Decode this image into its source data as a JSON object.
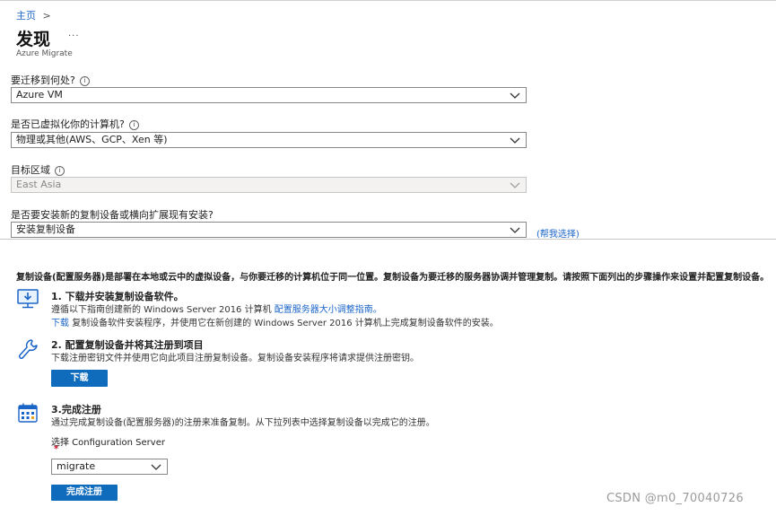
{
  "breadcrumb": {
    "home": "主页",
    "separator": ">"
  },
  "header": {
    "title": "发现",
    "more": "···",
    "subtitle": "Azure Migrate"
  },
  "form": {
    "q1": {
      "label": "要迁移到何处?",
      "value": "Azure VM"
    },
    "q2": {
      "label": "是否已虚拟化你的计算机?",
      "value": "物理或其他(AWS、GCP、Xen 等)"
    },
    "q3": {
      "label": "目标区域",
      "value": "East Asia"
    },
    "q4": {
      "label": "是否要安装新的复制设备或横向扩展现有安装?",
      "value": "安装复制设备",
      "help_link": "(帮我选择)"
    }
  },
  "intro": "复制设备(配置服务器)是部署在本地或云中的虚拟设备，与你要迁移的计算机位于同一位置。复制设备为要迁移的服务器协调并管理复制。请按照下面列出的步骤操作来设置并配置复制设备。",
  "steps": {
    "s1": {
      "title": "1. 下载并安装复制设备软件。",
      "line1_text": "遵循以下指南创建新的 Windows Server 2016 计算机",
      "line1_link": "配置服务器大小调整指南。",
      "line2_link": "下载",
      "line2_text": "复制设备软件安装程序，并使用它在新创建的 Windows Server 2016 计算机上完成复制设备软件的安装。"
    },
    "s2": {
      "title": "2. 配置复制设备并将其注册到项目",
      "desc": "下载注册密钥文件并使用它向此项目注册复制设备。复制设备安装程序将请求提供注册密钥。",
      "button": "下载"
    },
    "s3": {
      "title": "3.完成注册",
      "desc": "通过完成复制设备(配置服务器)的注册来准备复制。从下拉列表中选择复制设备以完成它的注册。",
      "select_label": "选择 Configuration Server",
      "required_mark": "*",
      "select_value": "migrate",
      "button": "完成注册"
    }
  },
  "watermark": "CSDN @m0_70040726",
  "colors": {
    "accent": "#0f6cbd",
    "link": "#1a64c8",
    "required": "#c50f1f"
  }
}
